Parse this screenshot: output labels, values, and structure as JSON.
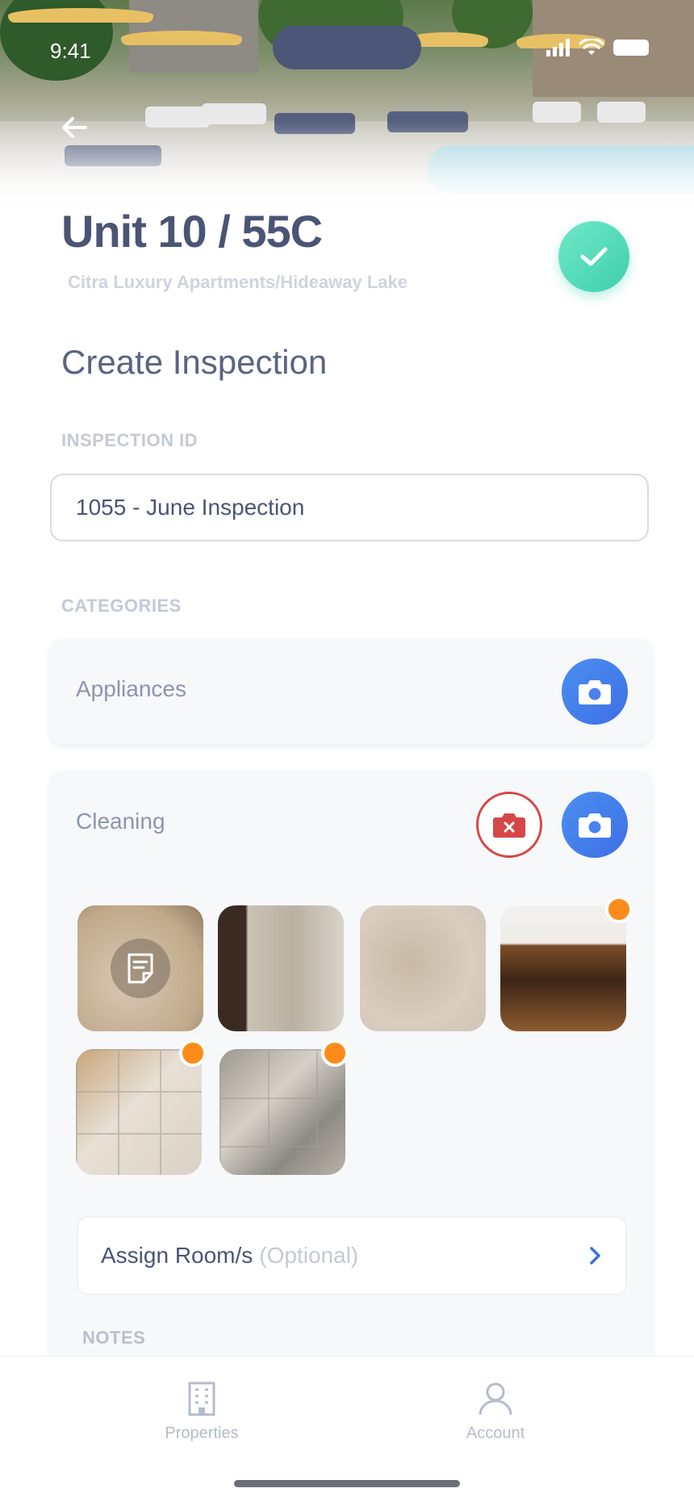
{
  "status": {
    "time": "9:41"
  },
  "header": {
    "unit_title": "Unit 10 / 55C",
    "property_path": "Citra Luxury Apartments/Hideaway Lake"
  },
  "page": {
    "heading": "Create Inspection"
  },
  "inspection_id": {
    "label": "INSPECTION ID",
    "value": "1055 - June Inspection"
  },
  "categories": {
    "label": "CATEGORIES",
    "items": [
      {
        "name": "Appliances"
      },
      {
        "name": "Cleaning",
        "photo_count": 6,
        "assign_label": "Assign Room/s",
        "assign_optional": "(Optional)",
        "notes_label": "NOTES"
      }
    ]
  },
  "tabs": [
    {
      "label": "Properties",
      "icon": "building-icon"
    },
    {
      "label": "Account",
      "icon": "user-icon"
    }
  ],
  "colors": {
    "accent_green": "#3fd0ac",
    "camera_blue": "#3f6fe6",
    "delete_red": "#d64747",
    "flag_orange": "#fb8c1a",
    "text_primary": "#4a5576"
  }
}
